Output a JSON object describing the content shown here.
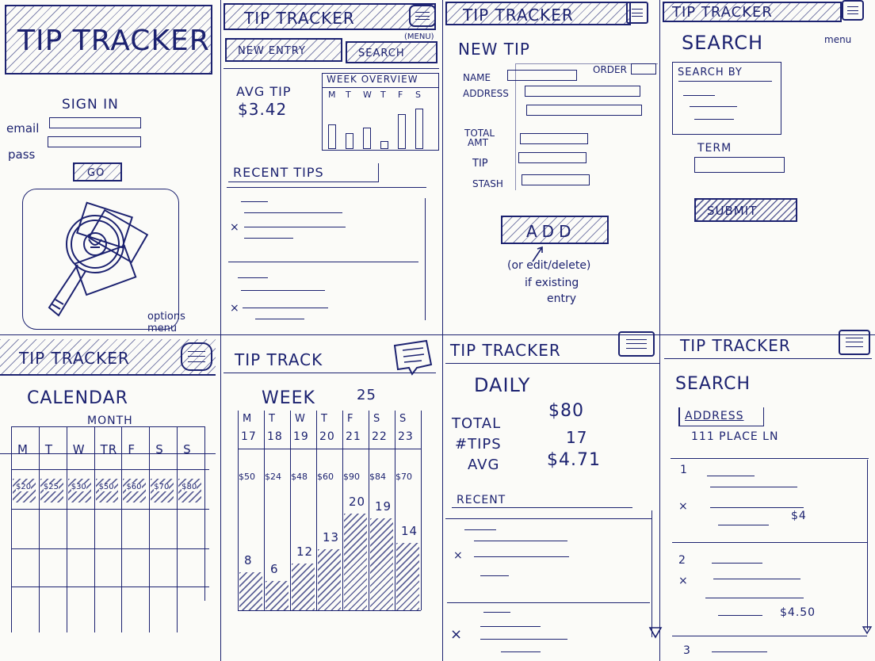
{
  "app_title": "TIP TRACKER",
  "screens": {
    "signin": {
      "title": "TIP TRACKER",
      "heading": "SIGN IN",
      "email_label": "email",
      "pass_label": "pass",
      "go_label": "GO",
      "options_note": "options menu",
      "icon": "magnifier-over-money-icon"
    },
    "home": {
      "title": "TIP TRACKER",
      "menu_note": "(MENU)",
      "new_entry": "NEW ENTRY",
      "search": "SEARCH",
      "avg_tip_label": "AVG TIP",
      "avg_tip_value": "$3.42",
      "week_overview": "WEEK OVERVIEW",
      "days": [
        "M",
        "T",
        "W",
        "T",
        "F",
        "S"
      ],
      "bar_levels": [
        0.45,
        0.3,
        0.4,
        0.15,
        0.65,
        0.75
      ],
      "recent_tips": "RECENT TIPS"
    },
    "new_tip": {
      "title": "TIP TRACKER",
      "heading": "NEW TIP",
      "name_label": "NAME",
      "order_label": "ORDER",
      "address_label": "ADDRESS",
      "total_label_1": "TOTAL",
      "total_label_2": "AMT",
      "tip_label": "TIP",
      "stash_label": "STASH",
      "add_button": "ADD",
      "note_1": "(or edit/delete)",
      "note_2": "if existing",
      "note_3": "entry"
    },
    "search": {
      "title": "TIP TRACKER",
      "menu_note": "menu",
      "heading": "SEARCH",
      "search_by": "SEARCH BY",
      "term_label": "TERM",
      "submit": "SUBMIT"
    },
    "calendar": {
      "title": "TIP TRACKER",
      "heading": "CALENDAR",
      "month_label": "MONTH",
      "days": [
        "M",
        "T",
        "W",
        "TR",
        "F",
        "S",
        "S"
      ],
      "amounts": [
        "$20",
        "$25",
        "$30",
        "$50",
        "$60",
        "$70",
        "$80"
      ]
    },
    "week": {
      "title": "TIP TRACK",
      "heading": "WEEK",
      "week_number": "25",
      "days": [
        "M",
        "T",
        "W",
        "T",
        "F",
        "S",
        "S"
      ],
      "dates": [
        "17",
        "18",
        "19",
        "20",
        "21",
        "22",
        "23"
      ],
      "amounts": [
        "$50",
        "$24",
        "$48",
        "$60",
        "$90",
        "$84",
        "$70"
      ],
      "counts": [
        "8",
        "6",
        "12",
        "13",
        "20",
        "19",
        "14"
      ],
      "fill_levels": [
        0.28,
        0.22,
        0.35,
        0.45,
        0.72,
        0.68,
        0.5
      ]
    },
    "daily": {
      "title": "TIP TRACKER",
      "heading": "DAILY",
      "total_label": "TOTAL",
      "total_value": "$80",
      "tips_label": "#TIPS",
      "tips_value": "17",
      "avg_label": "AVG",
      "avg_value": "$4.71",
      "recent_label": "RECENT"
    },
    "search_results": {
      "title": "TIP TRACKER",
      "heading": "SEARCH",
      "filter_label": "ADDRESS",
      "filter_value": "111 PLACE LN",
      "result_numbers": [
        "1",
        "2",
        "3"
      ],
      "amount_1": "$4",
      "amount_2": "$4.50"
    }
  },
  "colors": {
    "ink": "#1c2270",
    "paper": "#fbfbf8"
  }
}
